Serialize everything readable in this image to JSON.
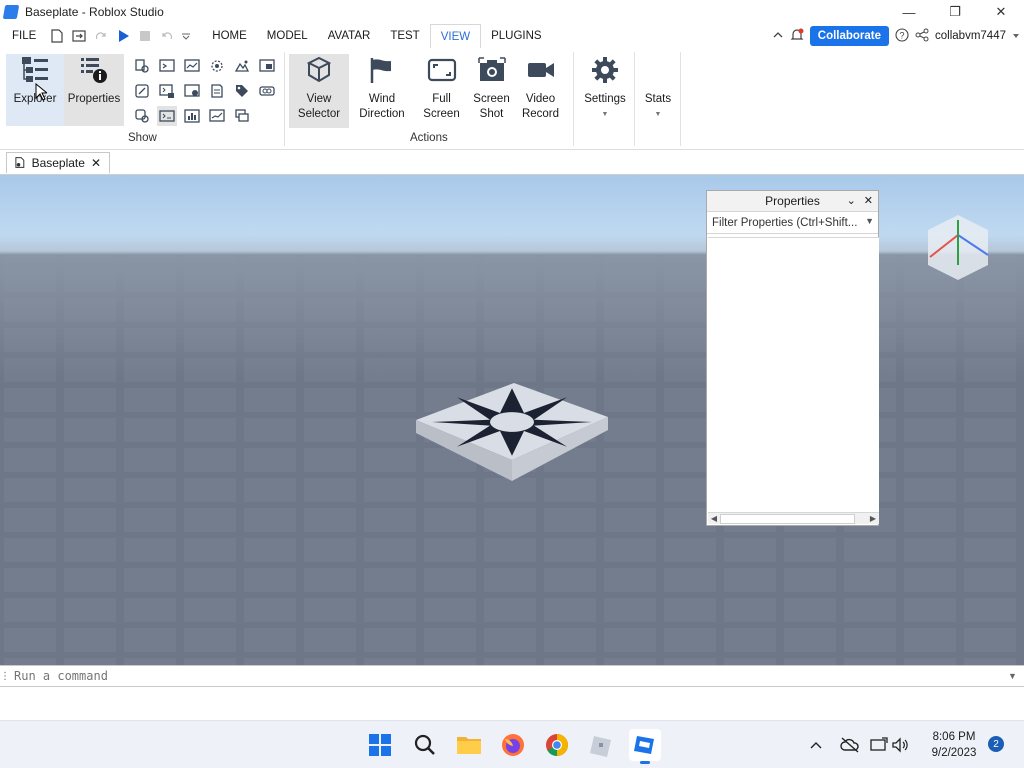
{
  "window": {
    "title": "Baseplate - Roblox Studio"
  },
  "menu": {
    "items": [
      {
        "label": "FILE"
      },
      {
        "label": "HOME"
      },
      {
        "label": "MODEL"
      },
      {
        "label": "AVATAR"
      },
      {
        "label": "TEST"
      },
      {
        "label": "VIEW",
        "active": true
      },
      {
        "label": "PLUGINS"
      }
    ],
    "collaborate_label": "Collaborate",
    "username": "collabvm7447"
  },
  "ribbon": {
    "show_group": {
      "label": "Show",
      "explorer_label": "Explorer",
      "properties_label": "Properties"
    },
    "actions_group": {
      "label": "Actions",
      "view_selector_line1": "View",
      "view_selector_line2": "Selector",
      "wind_line1": "Wind",
      "wind_line2": "Direction",
      "full_line1": "Full",
      "full_line2": "Screen",
      "shot_line1": "Screen",
      "shot_line2": "Shot",
      "video_line1": "Video",
      "video_line2": "Record"
    },
    "settings_label": "Settings",
    "stats_label": "Stats"
  },
  "tabs": {
    "doc_tab_label": "Baseplate"
  },
  "properties_panel": {
    "title": "Properties",
    "filter_placeholder": "Filter Properties (Ctrl+Shift..."
  },
  "command_bar": {
    "placeholder": "Run a command"
  },
  "taskbar": {
    "time": "8:06 PM",
    "date": "9/2/2023",
    "notification_count": "2"
  },
  "colors": {
    "accent": "#1a73e8",
    "tab_active_text": "#2b6fd6"
  }
}
